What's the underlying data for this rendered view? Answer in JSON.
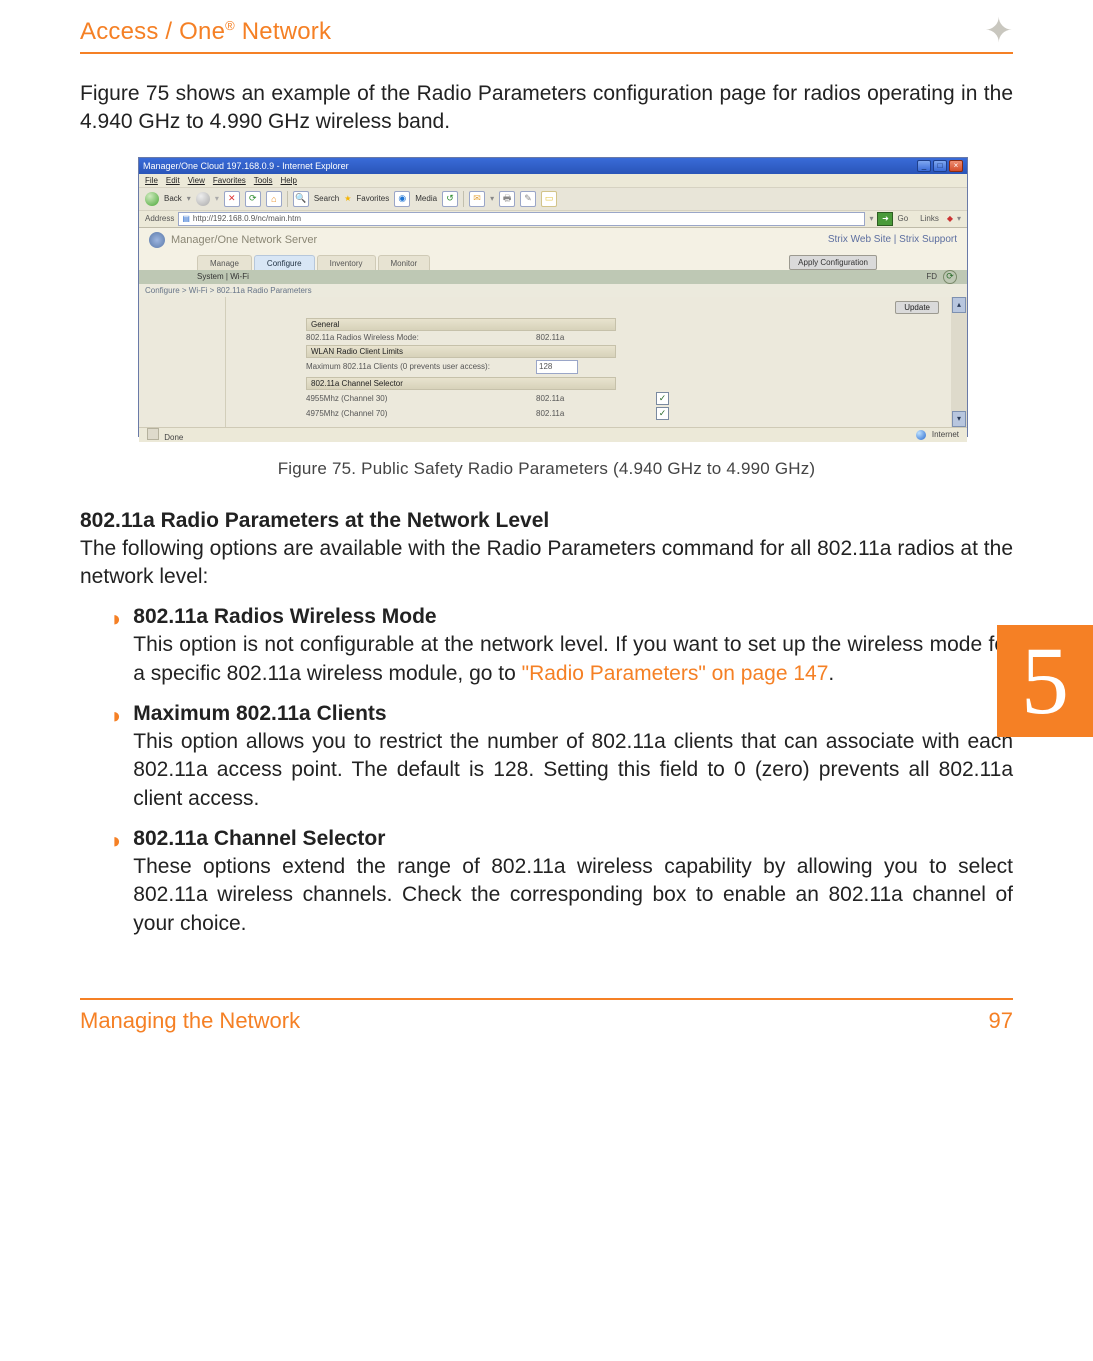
{
  "header": {
    "title_prefix": "Access / One",
    "title_sup": "®",
    "title_suffix": " Network",
    "glyph": "✦"
  },
  "intro_para": "Figure 75 shows an example of the Radio Parameters configuration page for radios operating in the 4.940 GHz to 4.990 GHz wireless band.",
  "screenshot": {
    "titlebar": "Manager/One Cloud 197.168.0.9 - Internet Explorer",
    "win_min": "_",
    "win_max": "□",
    "win_close": "×",
    "menu": {
      "file": "File",
      "edit": "Edit",
      "view": "View",
      "favorites": "Favorites",
      "tools": "Tools",
      "help": "Help"
    },
    "toolbar": {
      "back": "Back",
      "search": "Search",
      "favorites": "Favorites",
      "media": "Media"
    },
    "address_label": "Address",
    "address_value": "http://192.168.0.9/nc/main.htm",
    "go": "Go",
    "links": "Links",
    "brand": "Manager/One Network Server",
    "toplinks": "Strix Web Site  |  Strix Support",
    "tabs": {
      "manage": "Manage",
      "configure": "Configure",
      "inventory": "Inventory",
      "monitor": "Monitor"
    },
    "apply": "Apply Configuration",
    "subnav_left": "System  |  Wi-Fi",
    "subnav_right": "FD",
    "crumb": "Configure > Wi-Fi > 802.11a Radio Parameters",
    "update_btn": "Update",
    "section_general": "General",
    "row_mode_label": "802.11a Radios Wireless Mode:",
    "row_mode_value": "802.11a",
    "section_limits": "WLAN Radio Client Limits",
    "row_max_label": "Maximum 802.11a Clients (0 prevents user access):",
    "row_max_value": "128",
    "section_chsel": "802.11a Channel Selector",
    "ch1_label": "4955Mhz (Channel 30)",
    "ch1_val": "802.11a",
    "ch2_label": "4975Mhz (Channel 70)",
    "ch2_val": "802.11a",
    "check": "✓",
    "status_done": "Done",
    "status_zone": "Internet"
  },
  "figure_caption": "Figure 75. Public Safety Radio Parameters (4.940 GHz to 4.990 GHz)",
  "section": {
    "heading": "802.11a Radio Parameters at the Network Level",
    "intro": "The following options are available with the Radio Parameters command for all 802.11a radios at the network level:",
    "bullets": [
      {
        "title": "802.11a Radios Wireless Mode",
        "body_pre": "This option is not configurable at the network level. If you want to set up the wireless mode for a specific 802.11a wireless module, go to ",
        "link": "\"Radio Parameters\" on page 147",
        "body_post": "."
      },
      {
        "title": "Maximum 802.11a Clients",
        "body": "This option allows you to restrict the number of 802.11a clients that can associate with each 802.11a access point. The default is 128. Setting this field to 0 (zero) prevents all 802.11a client access."
      },
      {
        "title": "802.11a Channel Selector",
        "body": "These options extend the range of 802.11a wireless capability by allowing you to select 802.11a wireless channels. Check the corresponding box to enable an 802.11a channel of your choice."
      }
    ]
  },
  "side_tab": "5",
  "footer": {
    "left": "Managing the Network",
    "right": "97"
  }
}
